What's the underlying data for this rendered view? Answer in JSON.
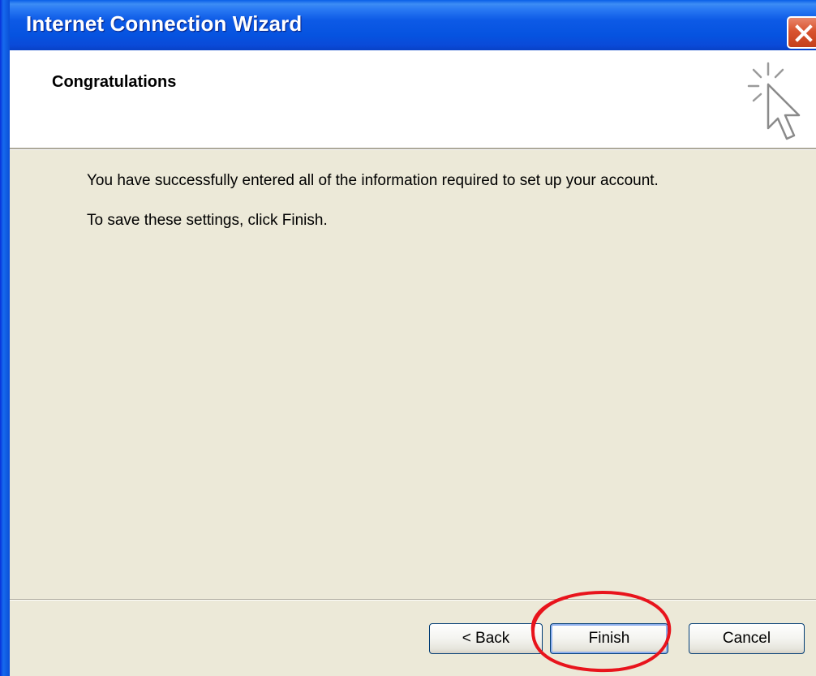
{
  "window": {
    "title": "Internet Connection Wizard"
  },
  "header": {
    "title": "Congratulations"
  },
  "body": {
    "line1": "You have successfully entered all of the information required to set up your account.",
    "line2": "To save these settings, click Finish."
  },
  "buttons": {
    "back": "< Back",
    "finish": "Finish",
    "cancel": "Cancel"
  },
  "icons": {
    "close": "close-icon",
    "wizard": "wizard-cursor-icon"
  },
  "colors": {
    "titlebar": "#0a5fe8",
    "dialog_bg": "#ece9d8",
    "close_button": "#d9542f",
    "annotation": "#e8141c"
  }
}
